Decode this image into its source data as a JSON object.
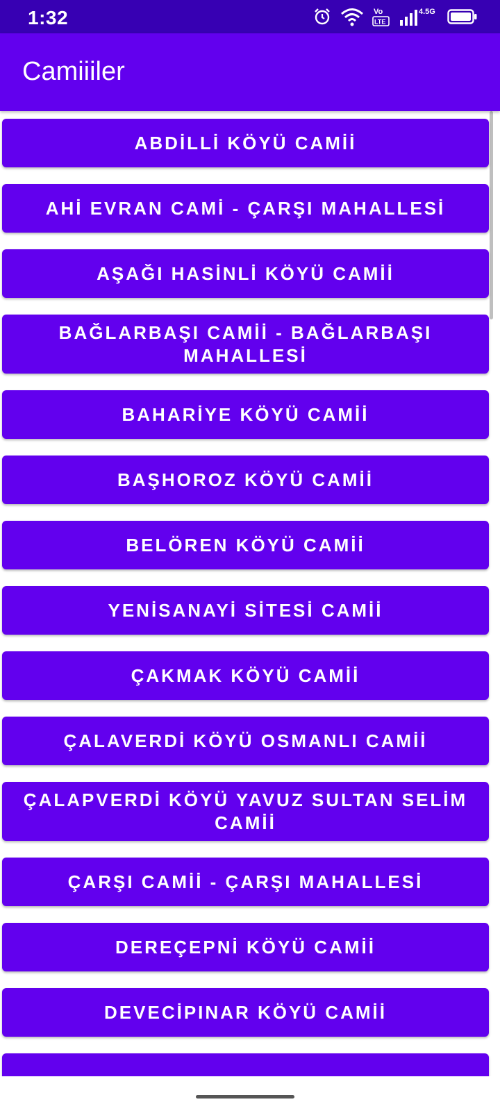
{
  "status_bar": {
    "time": "1:32",
    "network_label": "4.5G",
    "volte_label": "Vo LTE",
    "icons": [
      "alarm-icon",
      "wifi-icon",
      "volte-icon",
      "signal-icon",
      "battery-icon"
    ]
  },
  "app_bar": {
    "title": "Camiiiler"
  },
  "mosques": [
    {
      "label": "ABDİLLİ KÖYÜ CAMİİ"
    },
    {
      "label": "AHİ EVRAN CAMİ - ÇARŞI MAHALLESİ"
    },
    {
      "label": "AŞAĞI HASİNLİ KÖYÜ CAMİİ"
    },
    {
      "label": "BAĞLARBAŞI CAMİİ - BAĞLARBAŞI MAHALLESİ"
    },
    {
      "label": "BAHARİYE KÖYÜ CAMİİ"
    },
    {
      "label": "BAŞHOROZ KÖYÜ CAMİİ"
    },
    {
      "label": "BELÖREN KÖYÜ CAMİİ"
    },
    {
      "label": "YENİSANAYİ SİTESİ CAMİİ"
    },
    {
      "label": "ÇAKMAK KÖYÜ CAMİİ"
    },
    {
      "label": "ÇALAVERDİ KÖYÜ  OSMANLI CAMİİ"
    },
    {
      "label": "ÇALAPVERDİ KÖYÜ YAVUZ SULTAN SELİM CAMİİ"
    },
    {
      "label": "ÇARŞI CAMİİ - ÇARŞI MAHALLESİ"
    },
    {
      "label": "DEREÇEPNİ KÖYÜ CAMİİ"
    },
    {
      "label": "DEVECİPINAR KÖYÜ CAMİİ"
    },
    {
      "label": ""
    }
  ],
  "colors": {
    "primary": "#6200ee",
    "primary_dark": "#3700b3",
    "on_primary": "#ffffff"
  }
}
